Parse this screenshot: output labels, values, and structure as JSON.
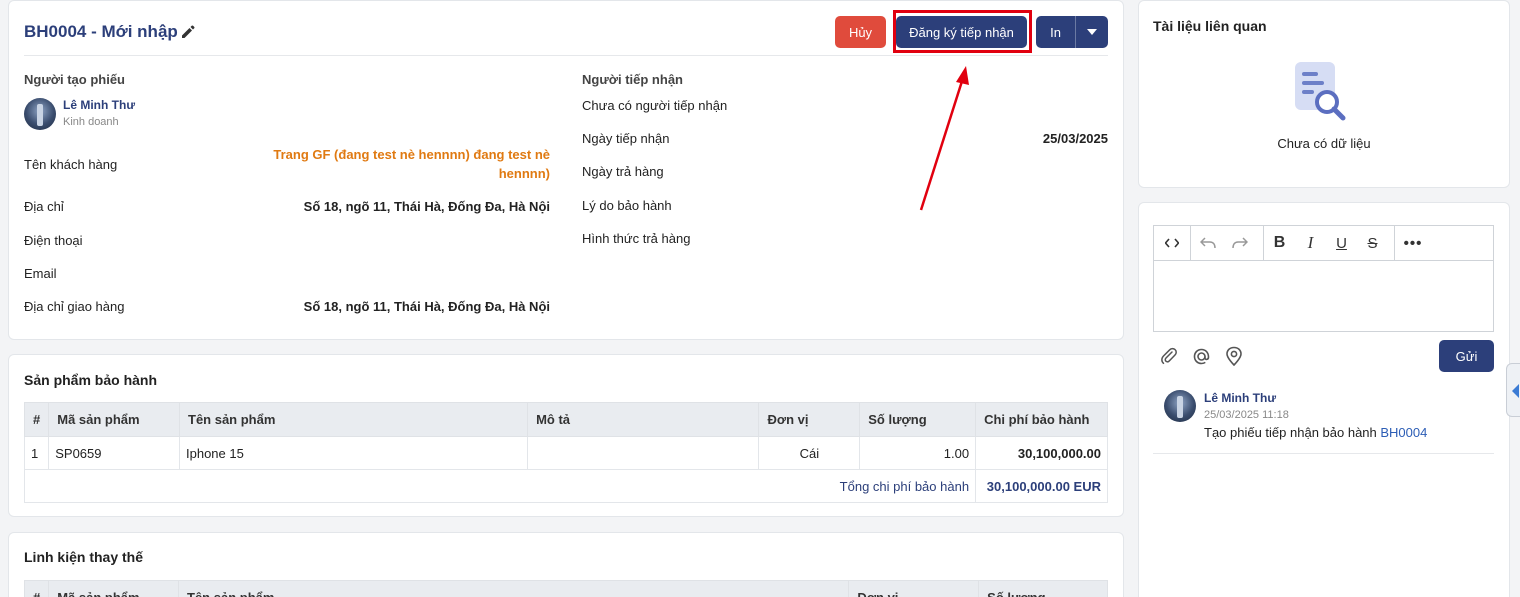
{
  "header": {
    "title": "BH0004 - Mới nhập",
    "cancel_label": "Hủy",
    "register_label": "Đăng ký tiếp nhận",
    "print_label": "In"
  },
  "creator": {
    "section_label": "Người tạo phiếu",
    "name": "Lê Minh Thư",
    "department": "Kinh doanh"
  },
  "left_fields": [
    {
      "label": "Tên khách hàng",
      "value": "Trang GF (đang test nè hennnn) đang test nè hennnn)"
    },
    {
      "label": "Địa chỉ",
      "value": "Số 18, ngõ 11, Thái Hà, Đống Đa, Hà Nội"
    },
    {
      "label": "Điện thoại",
      "value": ""
    },
    {
      "label": "Email",
      "value": ""
    },
    {
      "label": "Địa chỉ giao hàng",
      "value": "Số 18, ngõ 11, Thái Hà, Đống Đa, Hà Nội"
    }
  ],
  "receiver": {
    "section_label": "Người tiếp nhận",
    "status": "Chưa có người tiếp nhận"
  },
  "right_fields": [
    {
      "label": "Ngày tiếp nhận",
      "value": "25/03/2025"
    },
    {
      "label": "Ngày trả hàng",
      "value": ""
    },
    {
      "label": "Lý do bảo hành",
      "value": ""
    },
    {
      "label": "Hình thức trả hàng",
      "value": ""
    }
  ],
  "products": {
    "title": "Sản phẩm bảo hành",
    "columns": [
      "#",
      "Mã sản phẩm",
      "Tên sản phẩm",
      "Mô tả",
      "Đơn vị",
      "Số lượng",
      "Chi phí bảo hành"
    ],
    "rows": [
      {
        "no": "1",
        "code": "SP0659",
        "name": "Iphone 15",
        "desc": "",
        "unit": "Cái",
        "qty": "1.00",
        "cost": "30,100,000.00"
      }
    ],
    "total_label": "Tổng chi phí bảo hành",
    "total_value": "30,100,000.00 EUR"
  },
  "parts": {
    "title": "Linh kiện thay thế",
    "columns": [
      "#",
      "Mã sản phẩm",
      "Tên sản phẩm",
      "Đơn vị",
      "Số lượng"
    ]
  },
  "docs": {
    "title": "Tài liệu liên quan",
    "empty": "Chưa có dữ liệu"
  },
  "comment": {
    "send_label": "Gửi",
    "entry": {
      "author": "Lê Minh Thư",
      "time": "25/03/2025 11:18",
      "text_prefix": "Tạo phiếu tiếp nhận bảo hành ",
      "link": "BH0004"
    }
  },
  "colors": {
    "primary": "#2c3f7a",
    "danger": "#e04b3c",
    "accent_orange": "#e07a12",
    "highlight": "#e1000f"
  }
}
